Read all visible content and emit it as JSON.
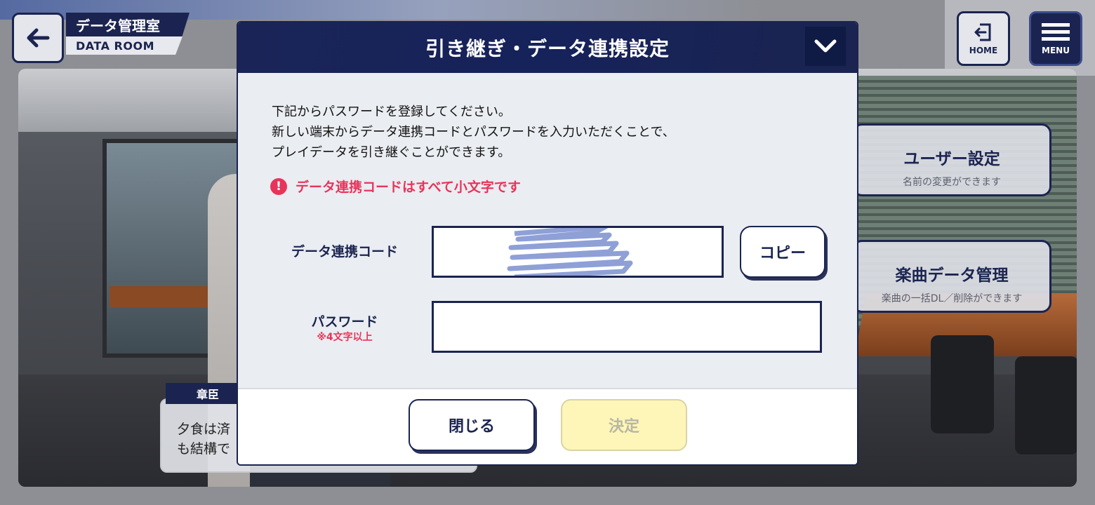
{
  "header": {
    "title_jp": "データ管理室",
    "title_en": "DATA ROOM",
    "home_label": "HOME",
    "menu_label": "MENU"
  },
  "side_panels": [
    {
      "title": "ユーザー設定",
      "subtitle": "名前の変更ができます"
    },
    {
      "title": "楽曲データ管理",
      "subtitle": "楽曲の一括DL／削除ができます"
    }
  ],
  "dialogue": {
    "speaker": "章臣",
    "line1": "夕食は済",
    "line2": "も結構で"
  },
  "modal": {
    "title": "引き継ぎ・データ連携設定",
    "instructions": [
      "下記からパスワードを登録してください。",
      "新しい端末からデータ連携コードとパスワードを入力いただくことで、",
      "プレイデータを引き継ぐことができます。"
    ],
    "notice": "データ連携コードはすべて小文字です",
    "notice_icon": "!",
    "code_label": "データ連携コード",
    "copy_label": "コピー",
    "password_label": "パスワード",
    "password_hint": "※4文字以上",
    "password_value": "",
    "close_label": "閉じる",
    "confirm_label": "決定"
  },
  "colors": {
    "navy": "#1b2450",
    "alert": "#e8345a",
    "confirm_disabled_bg": "#fdf6b8"
  },
  "icons": {
    "back": "arrow-left-icon",
    "home": "exit-door-icon",
    "menu": "hamburger-menu-icon",
    "collapse": "chevron-down-icon",
    "notice": "exclamation-circle-icon"
  }
}
